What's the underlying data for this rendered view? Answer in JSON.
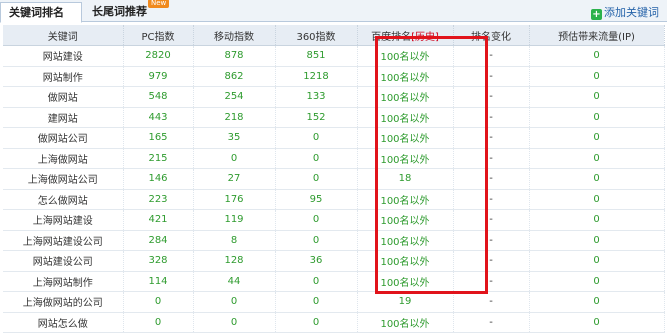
{
  "tabs": [
    {
      "label": "关键词排名",
      "active": true
    },
    {
      "label": "长尾词推荐",
      "badge": "New"
    }
  ],
  "add_keyword": "添加关键词",
  "headers": {
    "keyword": "关键词",
    "pc": "PC指数",
    "mobile": "移动指数",
    "s360": "360指数",
    "baidu_rank": "百度排名",
    "history": "[历史]",
    "change": "排名变化",
    "traffic": "预估带来流量(IP)"
  },
  "rows": [
    {
      "keyword": "网站建设",
      "pc": "2820",
      "mobile": "878",
      "s360": "851",
      "rank": "100名以外",
      "change": "-",
      "traffic": "0"
    },
    {
      "keyword": "网站制作",
      "pc": "979",
      "mobile": "862",
      "s360": "1218",
      "rank": "100名以外",
      "change": "-",
      "traffic": "0"
    },
    {
      "keyword": "做网站",
      "pc": "548",
      "mobile": "254",
      "s360": "133",
      "rank": "100名以外",
      "change": "-",
      "traffic": "0"
    },
    {
      "keyword": "建网站",
      "pc": "443",
      "mobile": "218",
      "s360": "152",
      "rank": "100名以外",
      "change": "-",
      "traffic": "0"
    },
    {
      "keyword": "做网站公司",
      "pc": "165",
      "mobile": "35",
      "s360": "0",
      "rank": "100名以外",
      "change": "-",
      "traffic": "0"
    },
    {
      "keyword": "上海做网站",
      "pc": "215",
      "mobile": "0",
      "s360": "0",
      "rank": "100名以外",
      "change": "-",
      "traffic": "0"
    },
    {
      "keyword": "上海做网站公司",
      "pc": "146",
      "mobile": "27",
      "s360": "0",
      "rank": "18",
      "change": "-",
      "traffic": "0"
    },
    {
      "keyword": "怎么做网站",
      "pc": "223",
      "mobile": "176",
      "s360": "95",
      "rank": "100名以外",
      "change": "-",
      "traffic": "0"
    },
    {
      "keyword": "上海网站建设",
      "pc": "421",
      "mobile": "119",
      "s360": "0",
      "rank": "100名以外",
      "change": "-",
      "traffic": "0"
    },
    {
      "keyword": "上海网站建设公司",
      "pc": "284",
      "mobile": "8",
      "s360": "0",
      "rank": "100名以外",
      "change": "-",
      "traffic": "0"
    },
    {
      "keyword": "网站建设公司",
      "pc": "328",
      "mobile": "128",
      "s360": "36",
      "rank": "100名以外",
      "change": "-",
      "traffic": "0"
    },
    {
      "keyword": "上海网站制作",
      "pc": "114",
      "mobile": "44",
      "s360": "0",
      "rank": "100名以外",
      "change": "-",
      "traffic": "0"
    },
    {
      "keyword": "上海做网站的公司",
      "pc": "0",
      "mobile": "0",
      "s360": "0",
      "rank": "19",
      "change": "-",
      "traffic": "0"
    },
    {
      "keyword": "网站怎么做",
      "pc": "0",
      "mobile": "0",
      "s360": "0",
      "rank": "100名以外",
      "change": "-",
      "traffic": "0"
    }
  ],
  "colors": {
    "number": "#2e9b2e",
    "highlight_box": "#e1131b",
    "history_link": "#d0021b"
  }
}
